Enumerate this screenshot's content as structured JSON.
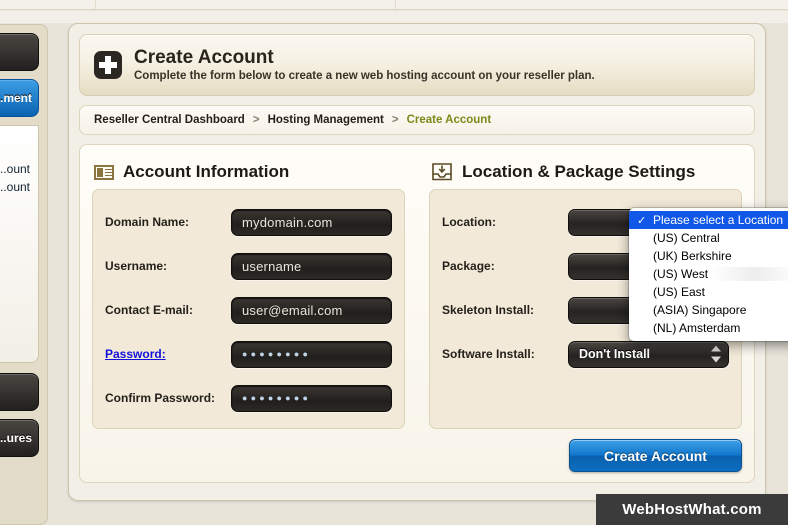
{
  "sidebar": {
    "top_button_label": "",
    "active_button_label": "...ment",
    "menu_links": [
      "...ount",
      "...ount"
    ],
    "lower_buttons": [
      "",
      "...ures"
    ]
  },
  "header": {
    "icon": "plus-box-icon",
    "title": "Create Account",
    "subtitle": "Complete the form below to create a new web hosting account on your reseller plan."
  },
  "breadcrumb": {
    "items": [
      {
        "label": "Reseller Central Dashboard",
        "current": false
      },
      {
        "label": "Hosting Management",
        "current": false
      },
      {
        "label": "Create Account",
        "current": true
      }
    ],
    "separator": ">"
  },
  "account_information": {
    "icon": "id-card-icon",
    "title": "Account Information",
    "fields": [
      {
        "label": "Domain Name:",
        "value": "mydomain.com",
        "type": "text",
        "is_link": false
      },
      {
        "label": "Username:",
        "value": "username",
        "type": "text",
        "is_link": false
      },
      {
        "label": "Contact E-mail:",
        "value": "user@email.com",
        "type": "text",
        "is_link": false
      },
      {
        "label": "Password:",
        "value": "●●●●●●●●",
        "type": "password",
        "is_link": true
      },
      {
        "label": "Confirm Password:",
        "value": "●●●●●●●●",
        "type": "password",
        "is_link": false
      }
    ]
  },
  "location_package": {
    "icon": "inbox-tray-icon",
    "title": "Location & Package Settings",
    "fields": [
      {
        "label": "Location:",
        "value": ""
      },
      {
        "label": "Package:",
        "value": ""
      },
      {
        "label": "Skeleton Install:",
        "value": ""
      },
      {
        "label": "Software Install:",
        "value": "Don't Install"
      }
    ]
  },
  "location_dropdown": {
    "open": true,
    "checkmark": "✓",
    "options": [
      {
        "label": "Please select a Location",
        "selected": true,
        "hovered": false
      },
      {
        "label": "(US) Central",
        "selected": false,
        "hovered": false
      },
      {
        "label": "(UK) Berkshire",
        "selected": false,
        "hovered": false
      },
      {
        "label": "(US) West",
        "selected": false,
        "hovered": true
      },
      {
        "label": "(US) East",
        "selected": false,
        "hovered": false
      },
      {
        "label": "(ASIA) Singapore",
        "selected": false,
        "hovered": false
      },
      {
        "label": "(NL) Amsterdam",
        "selected": false,
        "hovered": false
      }
    ]
  },
  "submit": {
    "label": "Create Account"
  },
  "watermark": {
    "label": "WebHostWhat.com"
  },
  "colors": {
    "accent_blue": "#1277cd",
    "selected_blue": "#1157e8",
    "breadcrumb_current": "#7b8a18",
    "link_blue": "#1111dd",
    "panel_bg": "#f2efe7",
    "field_box_bg": "#f2e9d8",
    "dark_input": "#211f1c"
  }
}
